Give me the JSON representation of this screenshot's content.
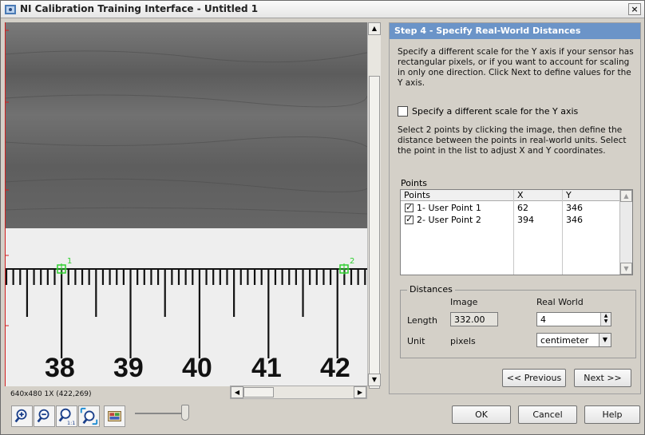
{
  "window": {
    "title": "NI Calibration Training Interface - Untitled 1",
    "close_glyph": "×"
  },
  "viewer": {
    "ruler_numbers": [
      "38",
      "39",
      "40",
      "41",
      "42"
    ],
    "point_markers": [
      "1",
      "2"
    ],
    "status": "640x480 1X   (422,269)"
  },
  "toolbar": {
    "icons": [
      "zoom-in-icon",
      "zoom-out-icon",
      "zoom-1to1-icon",
      "zoom-to-fit-icon",
      "image-settings-icon"
    ]
  },
  "panel": {
    "step_title": "Step 4 - Specify Real-World Distances",
    "intro": "Specify a different scale for the Y axis if your sensor has rectangular pixels, or if you want to account for scaling in only one direction. Click Next to define values for the Y axis.",
    "checkbox_label": "Specify a different scale for the Y axis",
    "instructions": "Select 2 points by clicking the image, then define the distance between the points in real-world units. Select the point in the list to adjust X and Y coordinates.",
    "points_label": "Points",
    "points_columns": [
      "Points",
      "X",
      "Y"
    ],
    "points": [
      {
        "name": "1- User Point 1",
        "x": "62",
        "y": "346",
        "checked": true
      },
      {
        "name": "2- User Point 2",
        "x": "394",
        "y": "346",
        "checked": true
      }
    ],
    "distances": {
      "legend": "Distances",
      "col_image": "Image",
      "col_real": "Real World",
      "length_label": "Length",
      "length_image": "332.00",
      "length_real": "4",
      "unit_label": "Unit",
      "unit_image": "pixels",
      "unit_real": "centimeter"
    },
    "prev_label": "<< Previous",
    "next_label": "Next >>"
  },
  "footer": {
    "ok_label": "OK",
    "cancel_label": "Cancel",
    "help_label": "Help"
  },
  "colors": {
    "header_blue": "#6b94c8",
    "marker_green": "#2fd02f",
    "guide_red": "#d02020"
  }
}
